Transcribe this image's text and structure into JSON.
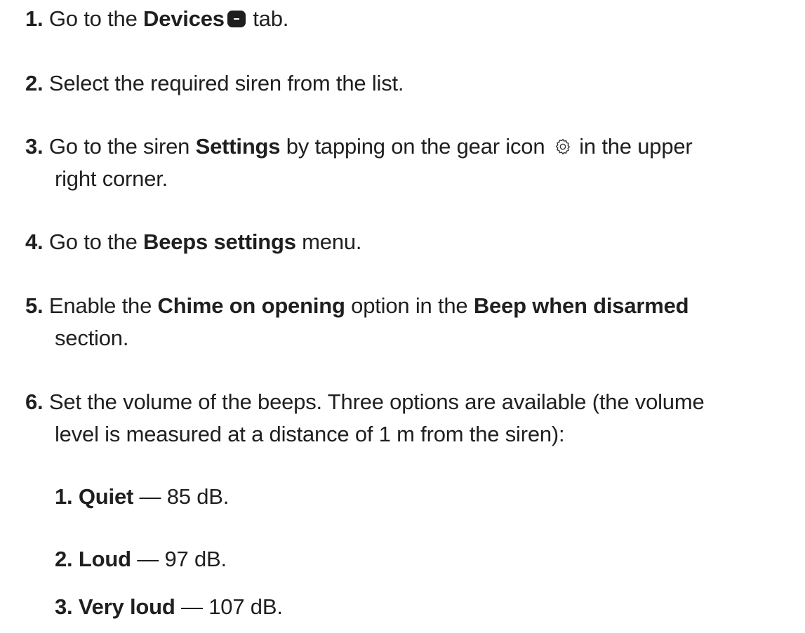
{
  "steps": [
    {
      "number": "1.",
      "parts": [
        "Go to the ",
        "Devices",
        " tab."
      ]
    },
    {
      "number": "2.",
      "text": "Select the required siren from the list."
    },
    {
      "number": "3.",
      "parts": [
        "Go to the siren ",
        "Settings",
        " by tapping on the gear icon ",
        " in the upper"
      ],
      "cont": "right corner."
    },
    {
      "number": "4.",
      "parts": [
        "Go to the ",
        "Beeps settings",
        " menu."
      ]
    },
    {
      "number": "5.",
      "parts": [
        "Enable the ",
        "Chime on opening",
        " option in the ",
        "Beep when disarmed"
      ],
      "cont": "section."
    },
    {
      "number": "6.",
      "line1": "Set the volume of the beeps. Three options are available (the volume",
      "cont": "level is measured at a distance of 1 m from the siren):"
    }
  ],
  "volume_options": [
    {
      "number": "1.",
      "name": "Quiet",
      "value": " — 85 dB."
    },
    {
      "number": "2.",
      "name": "Loud",
      "value": " — 97 dB."
    },
    {
      "number": "3.",
      "name": "Very loud",
      "value": " — 107 dB."
    }
  ],
  "icons": {
    "devices": "devices-tab-icon",
    "gear": "gear-icon"
  }
}
